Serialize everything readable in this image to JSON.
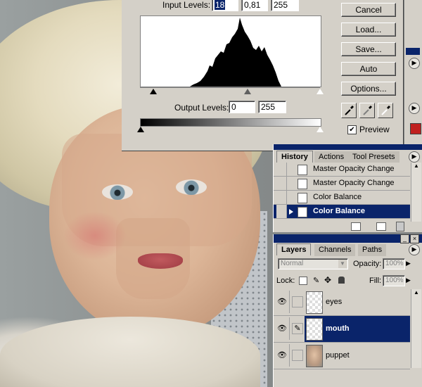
{
  "levels_dialog": {
    "input_levels_label": "Input Levels:",
    "input_black": "18",
    "input_gamma": "0,81",
    "input_white": "255",
    "output_levels_label": "Output Levels:",
    "output_black": "0",
    "output_white": "255",
    "buttons": {
      "cancel": "Cancel",
      "load": "Load...",
      "save": "Save...",
      "auto": "Auto",
      "options": "Options..."
    },
    "preview_label": "Preview",
    "preview_checked": true
  },
  "history_palette": {
    "tabs": [
      "History",
      "Actions",
      "Tool Presets"
    ],
    "items": [
      {
        "label": "Master Opacity Change",
        "selected": false
      },
      {
        "label": "Master Opacity Change",
        "selected": false
      },
      {
        "label": "Color Balance",
        "selected": false
      },
      {
        "label": "Color Balance",
        "selected": true
      }
    ]
  },
  "layers_palette": {
    "tabs": [
      "Layers",
      "Channels",
      "Paths"
    ],
    "blend_mode": "Normal",
    "opacity_label": "Opacity:",
    "opacity_value": "100%",
    "lock_label": "Lock:",
    "fill_label": "Fill:",
    "fill_value": "100%",
    "layers": [
      {
        "name": "eyes",
        "selected": false
      },
      {
        "name": "mouth",
        "selected": true
      },
      {
        "name": "puppet",
        "selected": false
      }
    ]
  },
  "colors": {
    "selection": "#0a246a",
    "panel": "#d4d0c8"
  }
}
